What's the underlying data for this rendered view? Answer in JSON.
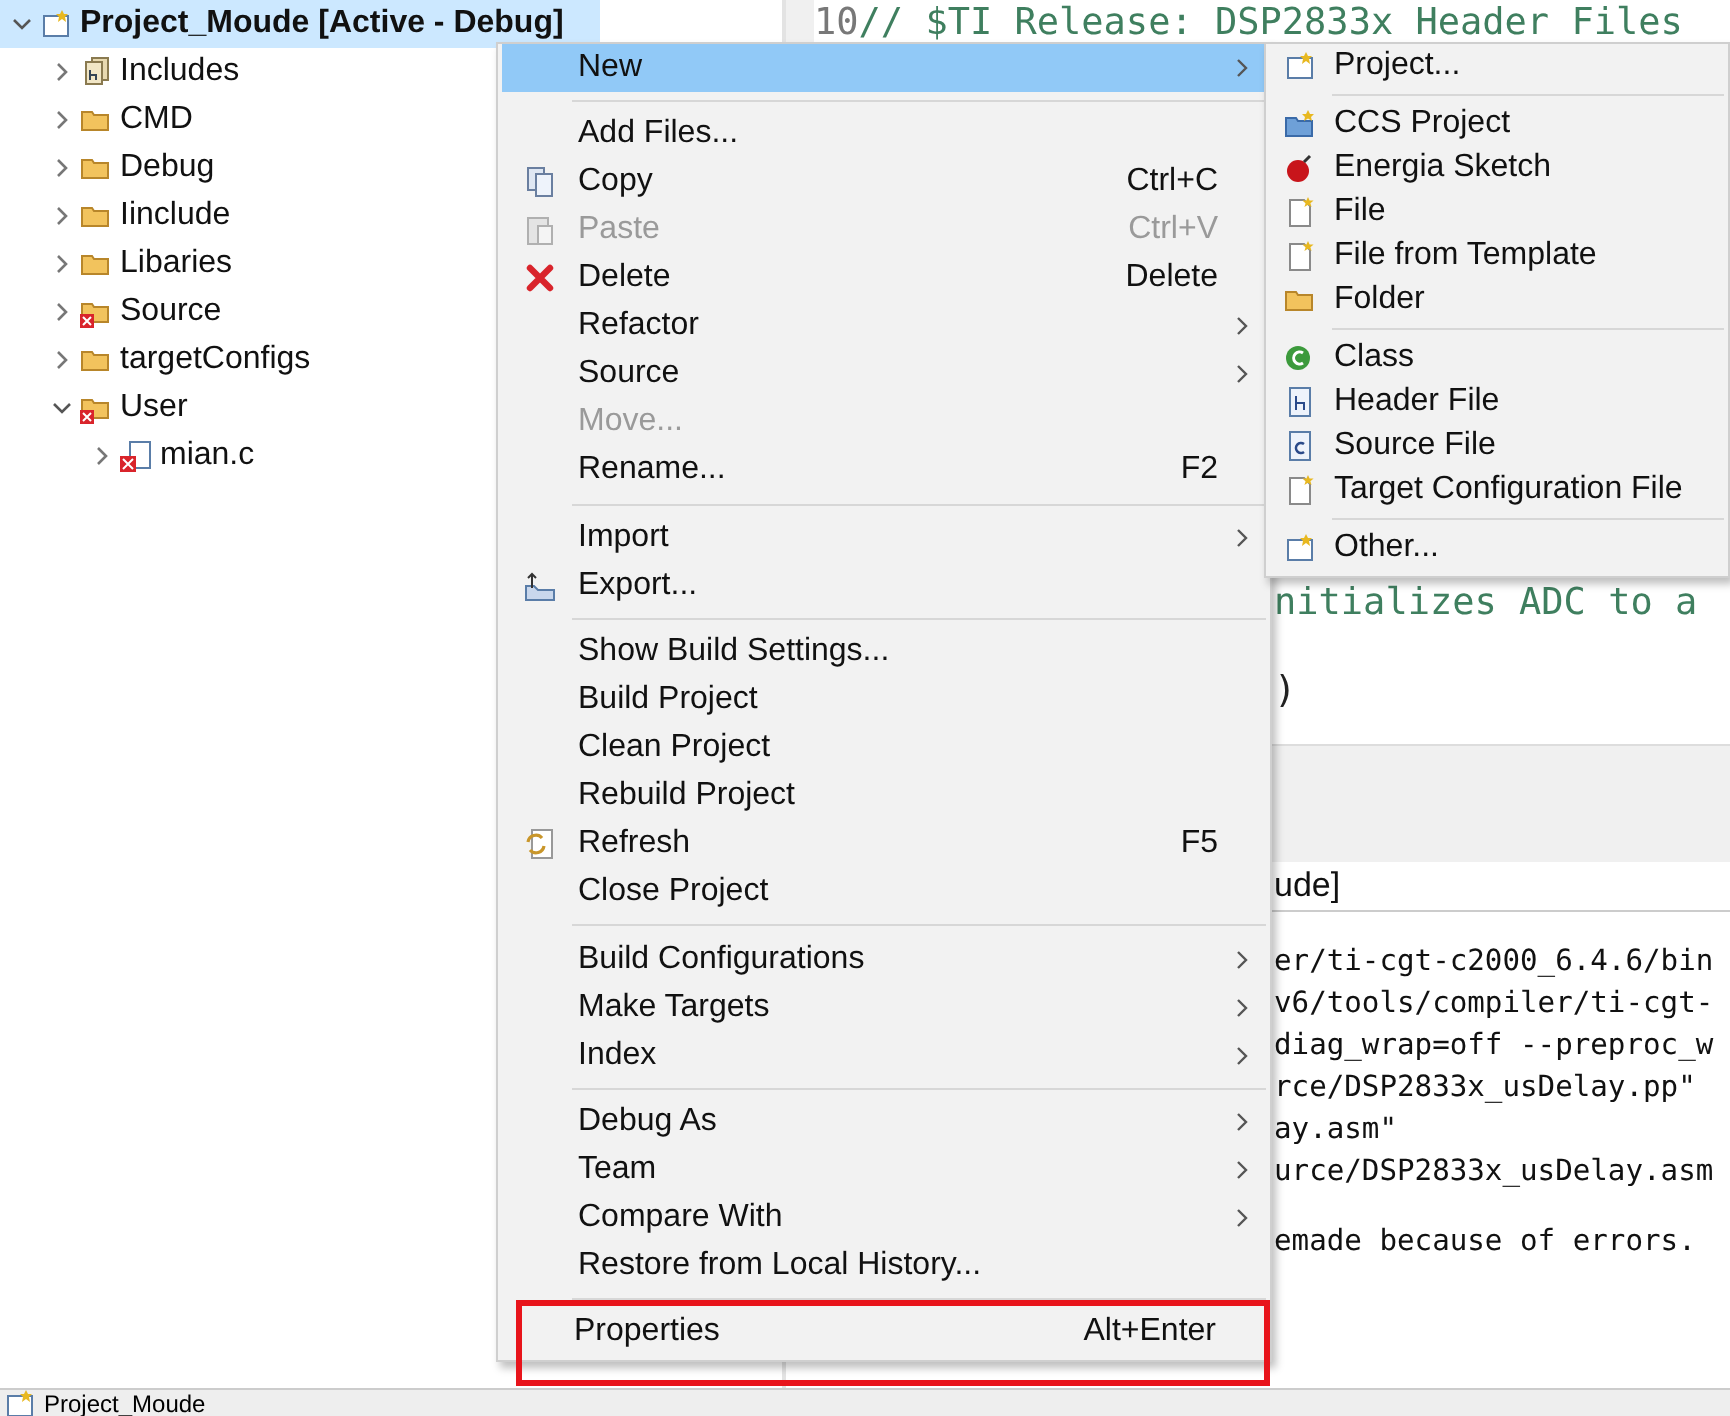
{
  "project_explorer": {
    "items": [
      {
        "label": "Project_Moude  [Active - Debug]",
        "kind": "project",
        "selected": true,
        "expanded": true,
        "children": [
          {
            "label": "Includes",
            "kind": "includes",
            "selected": false,
            "expanded": false
          },
          {
            "label": "CMD",
            "kind": "folder",
            "selected": false,
            "expanded": false
          },
          {
            "label": "Debug",
            "kind": "folder",
            "selected": false,
            "expanded": false
          },
          {
            "label": "Iinclude",
            "kind": "folder",
            "selected": false,
            "expanded": false
          },
          {
            "label": "Libaries",
            "kind": "folder",
            "selected": false,
            "expanded": false
          },
          {
            "label": "Source",
            "kind": "error-folder",
            "selected": false,
            "expanded": false
          },
          {
            "label": "targetConfigs",
            "kind": "folder",
            "selected": false,
            "expanded": false
          },
          {
            "label": "User",
            "kind": "error-folder",
            "selected": false,
            "expanded": true,
            "children": [
              {
                "label": "mian.c",
                "kind": "error-c-file",
                "selected": false,
                "expanded": false
              }
            ]
          }
        ]
      }
    ]
  },
  "editor": {
    "lines": [
      {
        "number": "10",
        "text": "// $TI Release: DSP2833x Header Files",
        "kind": "comment"
      },
      {
        "text": "nitializes ADC to a",
        "kind": "comment"
      },
      {
        "text": ")",
        "kind": "code"
      }
    ]
  },
  "console": {
    "title": "ude]",
    "lines": [
      "er/ti-cgt-c2000_6.4.6/bin",
      "v6/tools/compiler/ti-cgt-",
      "diag_wrap=off --preproc_w",
      "rce/DSP2833x_usDelay.pp\"",
      "ay.asm\"",
      "urce/DSP2833x_usDelay.asm",
      "emade because of errors."
    ]
  },
  "context_menu": {
    "items": [
      {
        "kind": "item",
        "label": "New",
        "submenu": true,
        "selected": true,
        "disabled": false,
        "boxed": false
      },
      {
        "kind": "separator"
      },
      {
        "kind": "item",
        "label": "Add Files...",
        "submenu": false,
        "selected": false,
        "disabled": false,
        "boxed": false
      },
      {
        "kind": "item",
        "label": "Copy",
        "shortcut": "Ctrl+C",
        "submenu": false,
        "selected": false,
        "disabled": false,
        "boxed": false
      },
      {
        "kind": "item",
        "label": "Paste",
        "shortcut": "Ctrl+V",
        "submenu": false,
        "selected": false,
        "disabled": true,
        "boxed": false
      },
      {
        "kind": "item",
        "label": "Delete",
        "shortcut": "Delete",
        "submenu": false,
        "selected": false,
        "disabled": false,
        "boxed": false
      },
      {
        "kind": "item",
        "label": "Refactor",
        "submenu": true,
        "selected": false,
        "disabled": false,
        "boxed": false
      },
      {
        "kind": "item",
        "label": "Source",
        "submenu": true,
        "selected": false,
        "disabled": false,
        "boxed": false
      },
      {
        "kind": "item",
        "label": "Move...",
        "submenu": false,
        "selected": false,
        "disabled": true,
        "boxed": false
      },
      {
        "kind": "item",
        "label": "Rename...",
        "shortcut": "F2",
        "submenu": false,
        "selected": false,
        "disabled": false,
        "boxed": false
      },
      {
        "kind": "separator"
      },
      {
        "kind": "item",
        "label": "Import",
        "submenu": true,
        "selected": false,
        "disabled": false,
        "boxed": false
      },
      {
        "kind": "item",
        "label": "Export...",
        "submenu": false,
        "selected": false,
        "disabled": false,
        "boxed": false
      },
      {
        "kind": "separator"
      },
      {
        "kind": "item",
        "label": "Show Build Settings...",
        "submenu": false,
        "selected": false,
        "disabled": false,
        "boxed": false
      },
      {
        "kind": "item",
        "label": "Build Project",
        "submenu": false,
        "selected": false,
        "disabled": false,
        "boxed": false
      },
      {
        "kind": "item",
        "label": "Clean Project",
        "submenu": false,
        "selected": false,
        "disabled": false,
        "boxed": false
      },
      {
        "kind": "item",
        "label": "Rebuild Project",
        "submenu": false,
        "selected": false,
        "disabled": false,
        "boxed": false
      },
      {
        "kind": "item",
        "label": "Refresh",
        "shortcut": "F5",
        "submenu": false,
        "selected": false,
        "disabled": false,
        "boxed": false
      },
      {
        "kind": "item",
        "label": "Close Project",
        "submenu": false,
        "selected": false,
        "disabled": false,
        "boxed": false
      },
      {
        "kind": "separator"
      },
      {
        "kind": "item",
        "label": "Build Configurations",
        "submenu": true,
        "selected": false,
        "disabled": false,
        "boxed": false
      },
      {
        "kind": "item",
        "label": "Make Targets",
        "submenu": true,
        "selected": false,
        "disabled": false,
        "boxed": false
      },
      {
        "kind": "item",
        "label": "Index",
        "submenu": true,
        "selected": false,
        "disabled": false,
        "boxed": false
      },
      {
        "kind": "separator"
      },
      {
        "kind": "item",
        "label": "Debug As",
        "submenu": true,
        "selected": false,
        "disabled": false,
        "boxed": false
      },
      {
        "kind": "item",
        "label": "Team",
        "submenu": true,
        "selected": false,
        "disabled": false,
        "boxed": false
      },
      {
        "kind": "item",
        "label": "Compare With",
        "submenu": true,
        "selected": false,
        "disabled": false,
        "boxed": false
      },
      {
        "kind": "item",
        "label": "Restore from Local History...",
        "submenu": false,
        "selected": false,
        "disabled": false,
        "boxed": false
      },
      {
        "kind": "separator"
      },
      {
        "kind": "item",
        "label": "Properties",
        "shortcut": "Alt+Enter",
        "submenu": false,
        "selected": false,
        "disabled": false,
        "boxed": true
      }
    ]
  },
  "new_submenu": {
    "items": [
      {
        "kind": "item",
        "label": "Project..."
      },
      {
        "kind": "separator"
      },
      {
        "kind": "item",
        "label": "CCS Project"
      },
      {
        "kind": "item",
        "label": "Energia Sketch"
      },
      {
        "kind": "item",
        "label": "File"
      },
      {
        "kind": "item",
        "label": "File from Template"
      },
      {
        "kind": "item",
        "label": "Folder"
      },
      {
        "kind": "separator"
      },
      {
        "kind": "item",
        "label": "Class"
      },
      {
        "kind": "item",
        "label": "Header File"
      },
      {
        "kind": "item",
        "label": "Source File"
      },
      {
        "kind": "item",
        "label": "Target Configuration File"
      },
      {
        "kind": "separator"
      },
      {
        "kind": "item",
        "label": "Other..."
      }
    ]
  },
  "status_bar": {
    "text": "Project_Moude"
  }
}
